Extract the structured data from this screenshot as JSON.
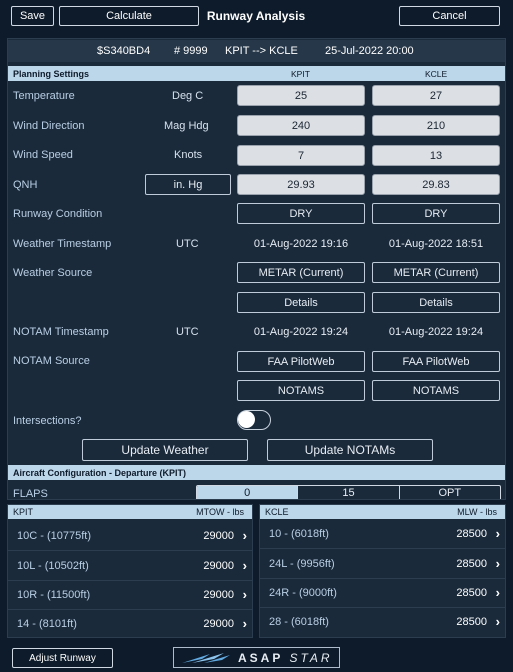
{
  "toolbar": {
    "save": "Save",
    "calculate": "Calculate",
    "title": "Runway Analysis",
    "cancel": "Cancel"
  },
  "flight": {
    "aircraft": "$S340BD4",
    "flight_no": "# 9999",
    "route": "KPIT --> KCLE",
    "datetime": "25-Jul-2022 20:00"
  },
  "planning": {
    "section_title": "Planning Settings",
    "col1": "KPIT",
    "col2": "KCLE",
    "temperature": {
      "label": "Temperature",
      "unit": "Deg C",
      "kpit": "25",
      "kcle": "27"
    },
    "wind_direction": {
      "label": "Wind Direction",
      "unit": "Mag Hdg",
      "kpit": "240",
      "kcle": "210"
    },
    "wind_speed": {
      "label": "Wind Speed",
      "unit": "Knots",
      "kpit": "7",
      "kcle": "13"
    },
    "qnh": {
      "label": "QNH",
      "unit": "in. Hg",
      "kpit": "29.93",
      "kcle": "29.83"
    },
    "runway_condition": {
      "label": "Runway Condition",
      "kpit": "DRY",
      "kcle": "DRY"
    },
    "weather_timestamp": {
      "label": "Weather Timestamp",
      "unit": "UTC",
      "kpit": "01-Aug-2022 19:16",
      "kcle": "01-Aug-2022 18:51"
    },
    "weather_source": {
      "label": "Weather Source",
      "kpit": "METAR (Current)",
      "kcle": "METAR (Current)"
    },
    "details": {
      "kpit": "Details",
      "kcle": "Details"
    },
    "notam_timestamp": {
      "label": "NOTAM Timestamp",
      "unit": "UTC",
      "kpit": "01-Aug-2022 19:24",
      "kcle": "01-Aug-2022 19:24"
    },
    "notam_source": {
      "label": "NOTAM Source",
      "kpit": "FAA PilotWeb",
      "kcle": "FAA PilotWeb"
    },
    "notams": {
      "kpit": "NOTAMS",
      "kcle": "NOTAMS"
    },
    "intersections": {
      "label": "Intersections?",
      "on": false
    },
    "update_weather": "Update Weather",
    "update_notams": "Update NOTAMs"
  },
  "aircraft_config": {
    "section_title": "Aircraft Configuration - Departure (KPIT)",
    "flaps_label": "FLAPS",
    "flaps_options": [
      "0",
      "15",
      "OPT"
    ],
    "flaps_selected": "0"
  },
  "departure": {
    "airport": "KPIT",
    "weight_label": "MTOW - lbs",
    "runways": [
      {
        "name": "10C - (10775ft)",
        "weight": "29000"
      },
      {
        "name": "10L - (10502ft)",
        "weight": "29000"
      },
      {
        "name": "10R - (11500ft)",
        "weight": "29000"
      },
      {
        "name": "14 - (8101ft)",
        "weight": "29000"
      }
    ]
  },
  "arrival": {
    "airport": "KCLE",
    "weight_label": "MLW - lbs",
    "runways": [
      {
        "name": "10 - (6018ft)",
        "weight": "28500"
      },
      {
        "name": "24L - (9956ft)",
        "weight": "28500"
      },
      {
        "name": "24R - (9000ft)",
        "weight": "28500"
      },
      {
        "name": "28 - (6018ft)",
        "weight": "28500"
      }
    ]
  },
  "footer": {
    "adjust_runway": "Adjust Runway",
    "logo_asap": "ASAP",
    "logo_star": "STAR"
  },
  "colors": {
    "background": "#0e1b2a",
    "panel": "#1a2a3b",
    "section": "#bcd6ea",
    "field": "#dcdfe3"
  }
}
